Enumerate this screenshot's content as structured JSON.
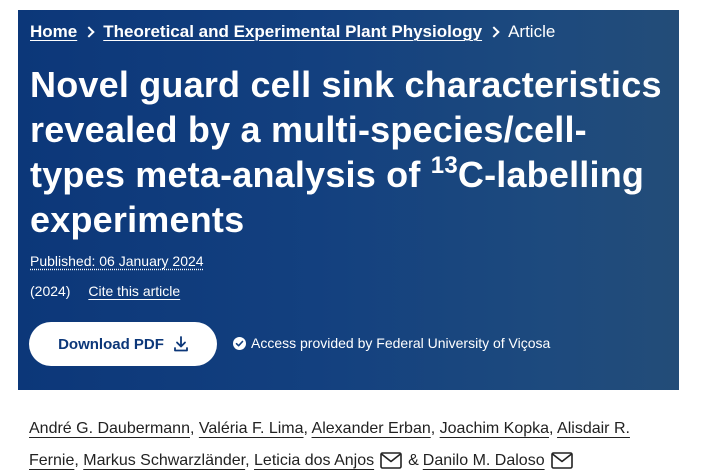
{
  "breadcrumb": {
    "home": "Home",
    "journal": "Theoretical and Experimental Plant Physiology",
    "current": "Article"
  },
  "article": {
    "title_part1": "Novel guard cell sink characteristics revealed by a multi-species/cell-types meta-analysis of ",
    "title_sup": "13",
    "title_part2": "C-labelling experiments",
    "published": "Published: 06 January 2024",
    "year": "(2024)",
    "cite_label": "Cite this article"
  },
  "actions": {
    "download_label": "Download PDF",
    "access_text": "Access provided by Federal University of Viçosa"
  },
  "authors": [
    "André G. Daubermann",
    "Valéria F. Lima",
    "Alexander Erban",
    "Joachim Kopka",
    "Alisdair R. Fernie",
    "Markus Schwarzländer",
    "Leticia dos Anjos",
    "Danilo M. Daloso"
  ],
  "amp": "&",
  "comma": ",",
  "colors": {
    "hero_bg": "#0c3779",
    "button_text": "#0c3779",
    "author_text": "#222222"
  }
}
